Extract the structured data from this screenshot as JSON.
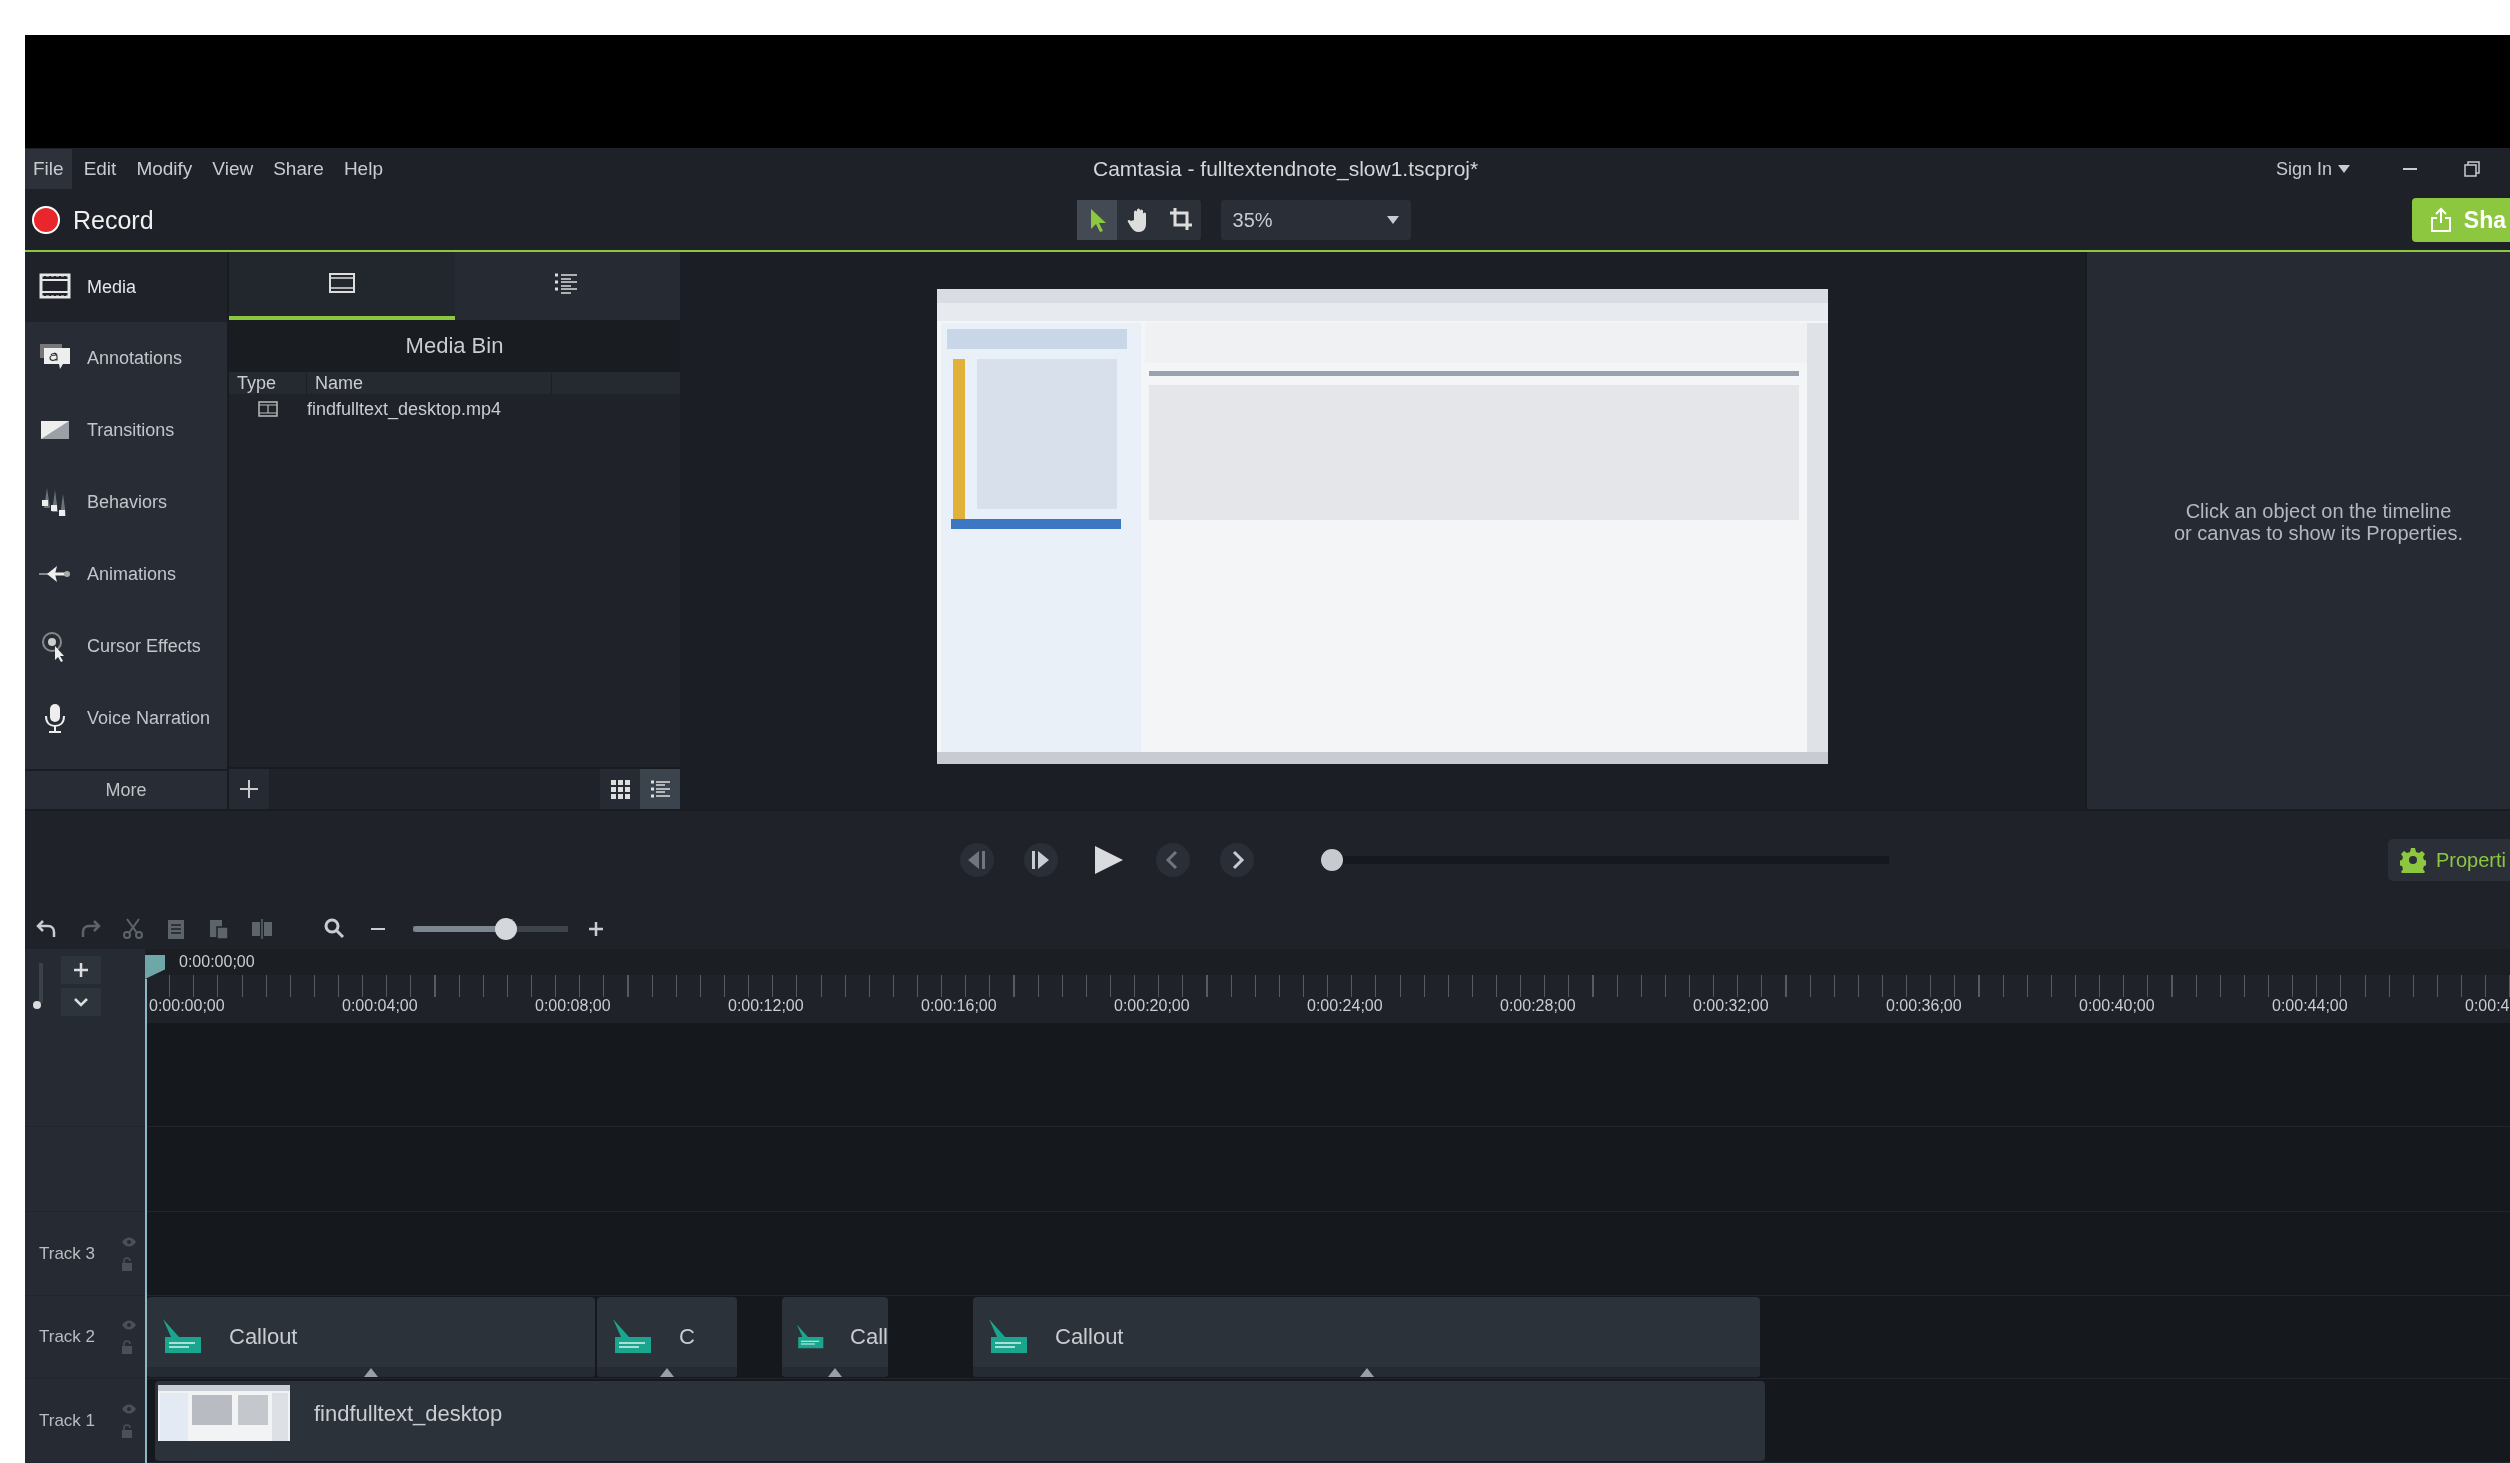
{
  "menu": [
    {
      "label": "File",
      "highlighted": true
    },
    {
      "label": "Edit",
      "highlighted": false
    },
    {
      "label": "Modify",
      "highlighted": false
    },
    {
      "label": "View",
      "highlighted": false
    },
    {
      "label": "Share",
      "highlighted": false
    },
    {
      "label": "Help",
      "highlighted": false
    }
  ],
  "window": {
    "title": "Camtasia - fulltextendnote_slow1.tscproj*",
    "sign_in": "Sign In"
  },
  "toolbar": {
    "record": "Record",
    "tools": [
      {
        "kind": "pointer",
        "selected": true
      },
      {
        "kind": "hand",
        "selected": false
      },
      {
        "kind": "crop",
        "selected": false
      }
    ],
    "zoom": "35%",
    "share": "Sha"
  },
  "sidebar": {
    "items": [
      {
        "kind": "media",
        "label": "Media",
        "selected": true
      },
      {
        "kind": "annotations",
        "label": "Annotations",
        "selected": false
      },
      {
        "kind": "transitions",
        "label": "Transitions",
        "selected": false
      },
      {
        "kind": "behaviors",
        "label": "Behaviors",
        "selected": false
      },
      {
        "kind": "animations",
        "label": "Animations",
        "selected": false
      },
      {
        "kind": "cursor",
        "label": "Cursor Effects",
        "selected": false
      },
      {
        "kind": "voice",
        "label": "Voice Narration",
        "selected": false
      }
    ],
    "more": "More"
  },
  "media_bin": {
    "tabs": [
      {
        "kind": "bin",
        "selected": true
      },
      {
        "kind": "library",
        "selected": false
      }
    ],
    "title": "Media Bin",
    "columns": [
      "Type",
      "Name"
    ],
    "rows": [
      {
        "name": "findfulltext_desktop.mp4"
      }
    ],
    "views": [
      {
        "kind": "grid",
        "selected": false
      },
      {
        "kind": "list",
        "selected": true
      }
    ]
  },
  "properties": {
    "hint": "Click an object on the timeline or canvas to show its Properties.",
    "button": "Properti"
  },
  "playback": {
    "scrub": {
      "level": 0
    }
  },
  "timeline": {
    "zoom": {
      "level": 0.62
    },
    "playhead": "0:00:00;00",
    "ticks": [
      "0:00:00;00",
      "0:00:04;00",
      "0:00:08;00",
      "0:00:12;00",
      "0:00:16;00",
      "0:00:20;00",
      "0:00:24;00",
      "0:00:28;00",
      "0:00:32;00",
      "0:00:36;00",
      "0:00:40;00",
      "0:00:44;00",
      "0:00:4"
    ],
    "tracks": [
      {
        "name": "Track 3"
      },
      {
        "name": "Track 2",
        "clips": [
          {
            "kind": "callout",
            "label": "Callout"
          },
          {
            "kind": "callout",
            "label": "C"
          },
          {
            "kind": "callout",
            "label": "Call"
          },
          {
            "kind": "callout",
            "label": "Callout"
          }
        ]
      },
      {
        "name": "Track 1",
        "clips": [
          {
            "kind": "video",
            "label": "findfulltext_desktop"
          }
        ]
      }
    ]
  }
}
